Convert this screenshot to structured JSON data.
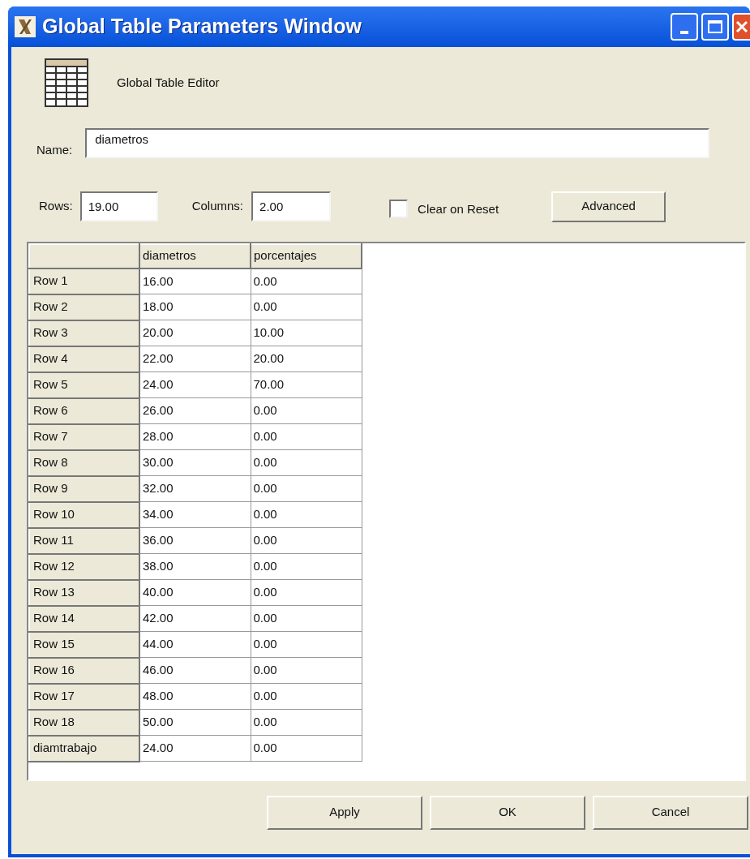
{
  "window": {
    "title": "Global Table Parameters Window"
  },
  "header": {
    "title": "Global Table Editor"
  },
  "name_field": {
    "label": "Name:",
    "value": "diametros"
  },
  "rows_field": {
    "label": "Rows:",
    "value": "19.00"
  },
  "columns_field": {
    "label": "Columns:",
    "value": "2.00"
  },
  "clear_on_reset": {
    "label": "Clear on Reset",
    "checked": false
  },
  "advanced_button": "Advanced",
  "table": {
    "columns": [
      "diametros",
      "porcentajes"
    ],
    "rows": [
      {
        "label": "Row 1",
        "cells": [
          "16.00",
          "0.00"
        ]
      },
      {
        "label": "Row 2",
        "cells": [
          "18.00",
          "0.00"
        ]
      },
      {
        "label": "Row 3",
        "cells": [
          "20.00",
          "10.00"
        ]
      },
      {
        "label": "Row 4",
        "cells": [
          "22.00",
          "20.00"
        ]
      },
      {
        "label": "Row 5",
        "cells": [
          "24.00",
          "70.00"
        ]
      },
      {
        "label": "Row 6",
        "cells": [
          "26.00",
          "0.00"
        ]
      },
      {
        "label": "Row 7",
        "cells": [
          "28.00",
          "0.00"
        ]
      },
      {
        "label": "Row 8",
        "cells": [
          "30.00",
          "0.00"
        ]
      },
      {
        "label": "Row 9",
        "cells": [
          "32.00",
          "0.00"
        ]
      },
      {
        "label": "Row 10",
        "cells": [
          "34.00",
          "0.00"
        ]
      },
      {
        "label": "Row 11",
        "cells": [
          "36.00",
          "0.00"
        ]
      },
      {
        "label": "Row 12",
        "cells": [
          "38.00",
          "0.00"
        ]
      },
      {
        "label": "Row 13",
        "cells": [
          "40.00",
          "0.00"
        ]
      },
      {
        "label": "Row 14",
        "cells": [
          "42.00",
          "0.00"
        ]
      },
      {
        "label": "Row 15",
        "cells": [
          "44.00",
          "0.00"
        ]
      },
      {
        "label": "Row 16",
        "cells": [
          "46.00",
          "0.00"
        ]
      },
      {
        "label": "Row 17",
        "cells": [
          "48.00",
          "0.00"
        ]
      },
      {
        "label": "Row 18",
        "cells": [
          "50.00",
          "0.00"
        ]
      },
      {
        "label": "diamtrabajo",
        "cells": [
          "24.00",
          "0.00"
        ]
      }
    ]
  },
  "buttons": [
    "Apply",
    "OK",
    "Cancel"
  ]
}
